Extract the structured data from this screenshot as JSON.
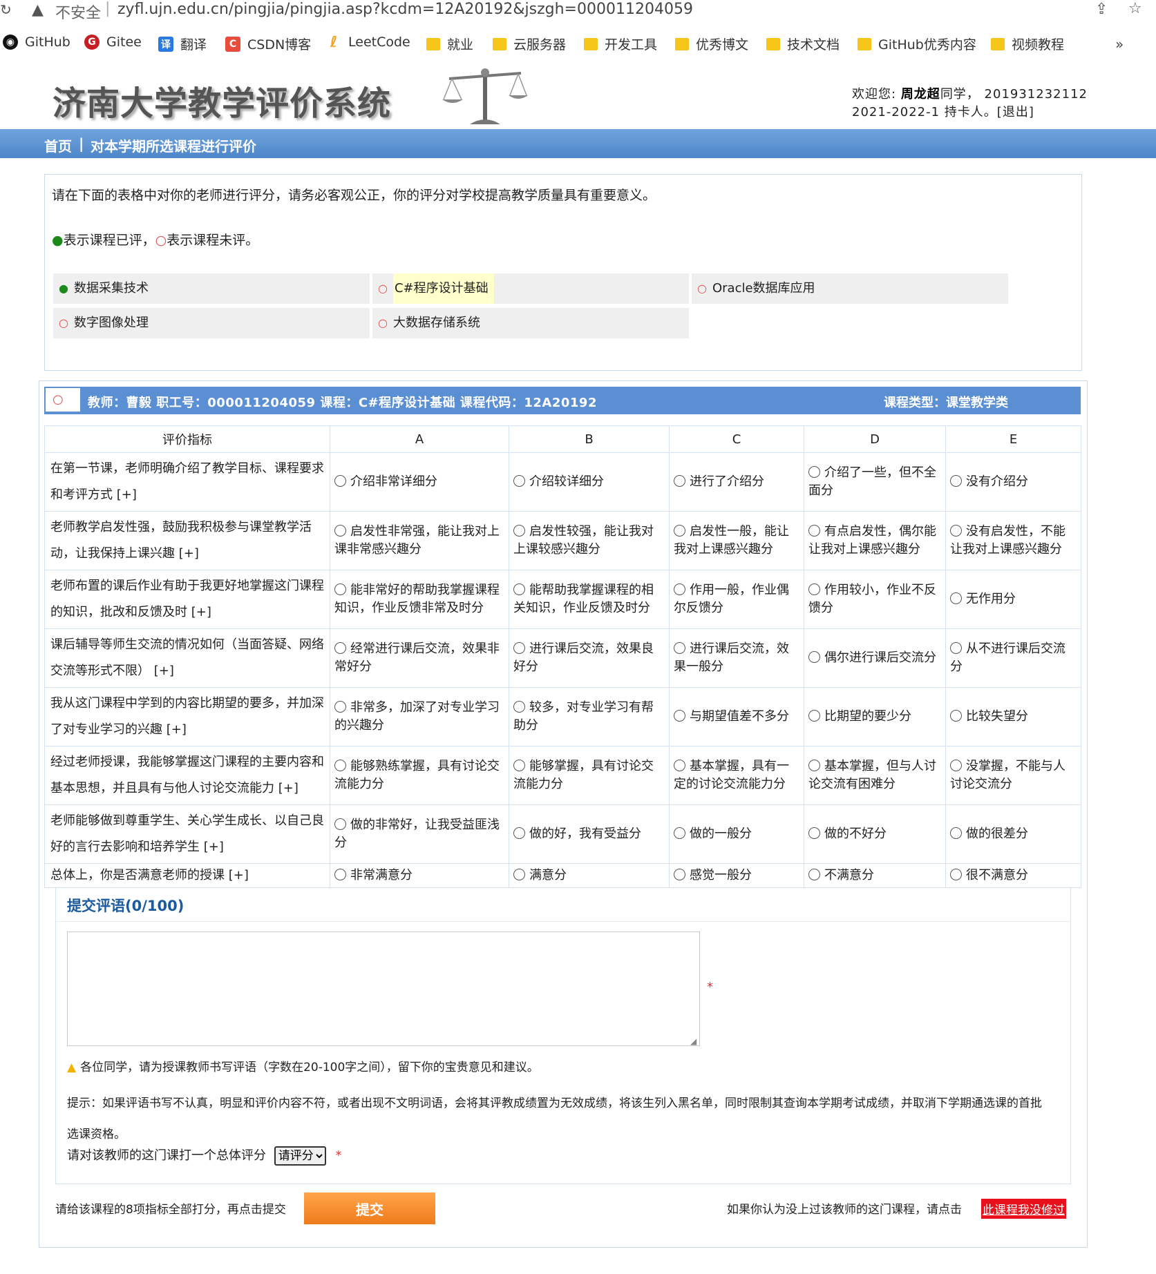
{
  "browser": {
    "security_label": "不安全",
    "url": "zyfl.ujn.edu.cn/pingjia/pingjia.asp?kcdm=12A20192&jszgh=000011204059",
    "bookmarks": [
      "GitHub",
      "Gitee",
      "翻译",
      "CSDN博客",
      "LeetCode",
      "就业",
      "云服务器",
      "开发工具",
      "优秀博文",
      "技术文档",
      "GitHub优秀内容",
      "视频教程"
    ]
  },
  "header": {
    "system_title": "济南大学教学评价系统",
    "welcome_prefix": "欢迎您:",
    "student_name": "周龙超",
    "student_suffix": "同学，",
    "student_id": "201931232112",
    "term": "2021-2022-1",
    "holder": "持卡人。",
    "logout": "[退出]"
  },
  "nav": {
    "home": "首页",
    "separator": "|",
    "current": "对本学期所选课程进行评价"
  },
  "intro": {
    "instruction": "请在下面的表格中对你的老师进行评分，请务必客观公正，你的评分对学校提高教学质量具有重要意义。",
    "legend_done_dot": "●",
    "legend_done": "表示课程已评，",
    "legend_todo_dot": "○",
    "legend_todo": "表示课程未评。",
    "courses": [
      {
        "status": "●",
        "name": "数据采集技术"
      },
      {
        "status": "○",
        "name": "C#程序设计基础"
      },
      {
        "status": "○",
        "name": "Oracle数据库应用"
      },
      {
        "status": "○",
        "name": "数字图像处理"
      },
      {
        "status": "○",
        "name": "大数据存储系统"
      }
    ]
  },
  "course_bar": {
    "status": "○",
    "info": "教师：曹毅  职工号：000011204059  课程：C#程序设计基础  课程代码：12A20192",
    "type": "课程类型：课堂教学类"
  },
  "table": {
    "headers": [
      "评价指标",
      "A",
      "B",
      "C",
      "D",
      "E"
    ],
    "rows": [
      {
        "indicator": "在第一节课，老师明确介绍了教学目标、课程要求和考评方式 [+]",
        "options": [
          "介绍非常详细分",
          "介绍较详细分",
          "进行了介绍分",
          "介绍了一些，但不全面分",
          "没有介绍分"
        ]
      },
      {
        "indicator": "老师教学启发性强，鼓励我积极参与课堂教学活动，让我保持上课兴趣 [+]",
        "options": [
          "启发性非常强，能让我对上课非常感兴趣分",
          "启发性较强，能让我对上课较感兴趣分",
          "启发性一般，能让我对上课感兴趣分",
          "有点启发性，偶尔能让我对上课感兴趣分",
          "没有启发性，不能让我对上课感兴趣分"
        ]
      },
      {
        "indicator": "老师布置的课后作业有助于我更好地掌握这门课程的知识，批改和反馈及时 [+]",
        "options": [
          "能非常好的帮助我掌握课程知识，作业反馈非常及时分",
          "能帮助我掌握课程的相关知识，作业反馈及时分",
          "作用一般，作业偶尔反馈分",
          "作用较小，作业不反馈分",
          "无作用分"
        ]
      },
      {
        "indicator": "课后辅导等师生交流的情况如何（当面答疑、网络交流等形式不限） [+]",
        "options": [
          "经常进行课后交流，效果非常好分",
          "进行课后交流，效果良好分",
          "进行课后交流，效果一般分",
          "偶尔进行课后交流分",
          "从不进行课后交流分"
        ]
      },
      {
        "indicator": "我从这门课程中学到的内容比期望的要多，并加深了对专业学习的兴趣 [+]",
        "options": [
          "非常多，加深了对专业学习的兴趣分",
          "较多，对专业学习有帮助分",
          "与期望值差不多分",
          "比期望的要少分",
          "比较失望分"
        ]
      },
      {
        "indicator": "经过老师授课，我能够掌握这门课程的主要内容和基本思想，并且具有与他人讨论交流能力 [+]",
        "options": [
          "能够熟练掌握，具有讨论交流能力分",
          "能够掌握，具有讨论交流能力分",
          "基本掌握，具有一定的讨论交流能力分",
          "基本掌握，但与人讨论交流有困难分",
          "没掌握，不能与人讨论交流分"
        ]
      },
      {
        "indicator": "老师能够做到尊重学生、关心学生成长、以自己良好的言行去影响和培养学生 [+]",
        "options": [
          "做的非常好，让我受益匪浅分",
          "做的好，我有受益分",
          "做的一般分",
          "做的不好分",
          "做的很差分"
        ]
      },
      {
        "indicator": "总体上，你是否满意老师的授课 [+]",
        "options": [
          "非常满意分",
          "满意分",
          "感觉一般分",
          "不满意分",
          "很不满意分"
        ]
      }
    ]
  },
  "comment": {
    "title": "提交评语(0/100)",
    "required_mark": "*",
    "warning": "各位同学，请为授课教师书写评语（字数在20-100字之间），留下你的宝贵意见和建议。",
    "tip": "提示：如果评语书写不认真，明显和评价内容不符，或者出现不文明词语，会将其评教成绩置为无效成绩，将该生列入黑名单，同时限制其查询本学期考试成绩，并取消下学期通选课的首批选课资格。",
    "rate_label": "请对该教师的这门课打一个总体评分",
    "rate_selected": "请评分"
  },
  "footer": {
    "left_text": "请给该课程的8项指标全部打分，再点击提交",
    "submit_label": "提交",
    "right_text": "如果你认为没上过该教师的这门课程，请点击",
    "not_attended": "此课程我没修过"
  }
}
